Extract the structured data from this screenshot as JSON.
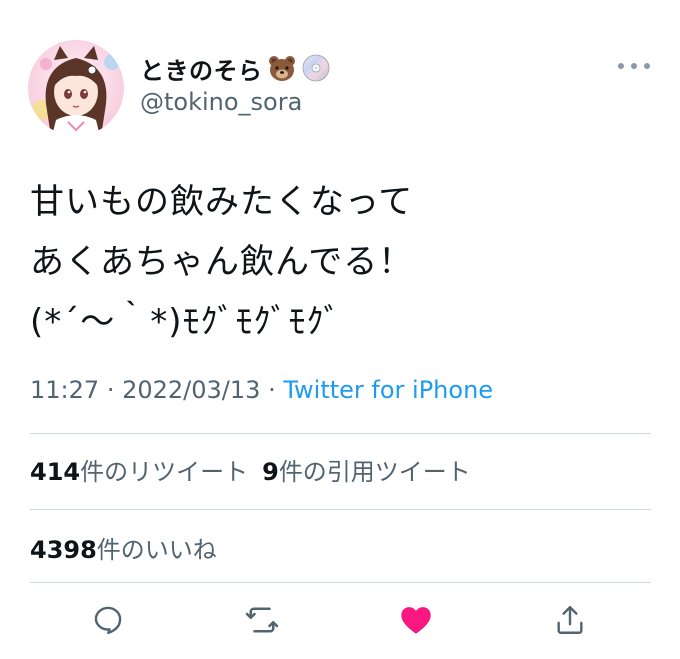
{
  "user": {
    "display_name": "ときのそら",
    "handle": "@tokino_sora",
    "badges": [
      "bear-emoji-icon",
      "disc-emoji-icon"
    ]
  },
  "tweet": {
    "text": "甘いもの飲みたくなって\nあくあちゃん飲んでる！\n(*´～｀*)ﾓｸﾞﾓｸﾞﾓｸﾞ",
    "time": "11:27",
    "date": "2022/03/13",
    "separator": "·",
    "source": "Twitter for iPhone"
  },
  "stats": {
    "retweets_count": "414",
    "retweets_label": "件のリツイート",
    "quotes_count": "9",
    "quotes_label": "件の引用ツイート",
    "likes_count": "4398",
    "likes_label": "件のいいね"
  },
  "actions": {
    "reply": "reply-icon",
    "retweet": "retweet-icon",
    "like": "heart-icon",
    "share": "share-icon"
  },
  "colors": {
    "text": "#0f1419",
    "secondary": "#536471",
    "link": "#1d9bf0",
    "like": "#f91880",
    "divider": "#cfd9de"
  }
}
